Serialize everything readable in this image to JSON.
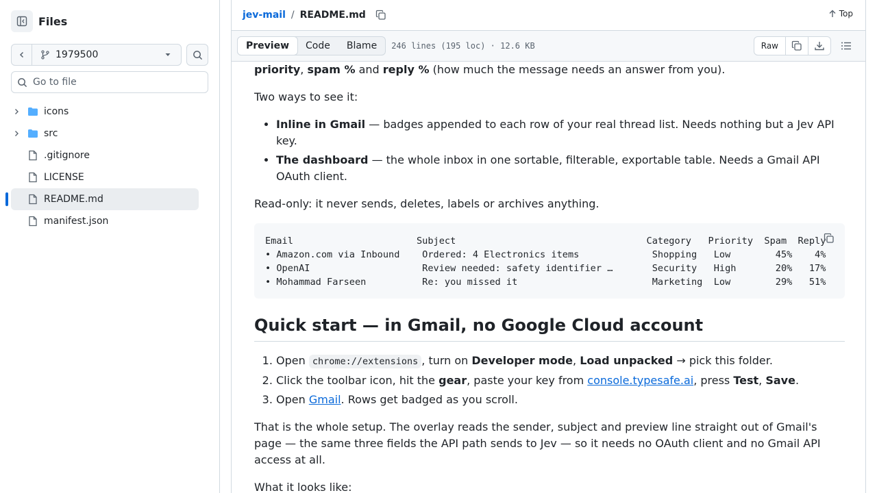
{
  "sidebar": {
    "title": "Files",
    "branch": "1979500",
    "goto_placeholder": "Go to file",
    "items": [
      {
        "label": "icons",
        "type": "folder"
      },
      {
        "label": "src",
        "type": "folder"
      },
      {
        "label": ".gitignore",
        "type": "file"
      },
      {
        "label": "LICENSE",
        "type": "file"
      },
      {
        "label": "README.md",
        "type": "file",
        "active": true
      },
      {
        "label": "manifest.json",
        "type": "file"
      }
    ]
  },
  "header": {
    "repo": "jev-mail",
    "separator": "/",
    "file": "README.md",
    "top_label": "Top"
  },
  "toolbar": {
    "tabs": [
      "Preview",
      "Code",
      "Blame"
    ],
    "active_tab": "Preview",
    "meta": "246 lines (195 loc) · 12.6 KB",
    "raw_label": "Raw"
  },
  "readme": {
    "intro_b1": "priority",
    "intro_s1": ", ",
    "intro_b2": "spam %",
    "intro_s2": " and ",
    "intro_b3": "reply %",
    "intro_s3": " (how much the message needs an answer from you).",
    "two_ways": "Two ways to see it:",
    "bullet1_b": "Inline in Gmail",
    "bullet1_t": " — badges appended to each row of your real thread list. Needs nothing but a Jev API key.",
    "bullet2_b": "The dashboard",
    "bullet2_t": " — the whole inbox in one sortable, filterable, exportable table. Needs a Gmail API OAuth client.",
    "readonly": "Read-only: it never sends, deletes, labels or archives anything.",
    "code_lines": [
      "Email                      Subject                                  Category   Priority  Spam  Reply",
      "• Amazon.com via Inbound    Ordered: 4 Electronics items             Shopping   Low        45%    4%",
      "• OpenAI                    Review needed: safety identifier …       Security   High       20%   17%",
      "• Mohammad Farseen          Re: you missed it                        Marketing  Low        29%   51%"
    ],
    "quickstart_heading": "Quick start — in Gmail, no Google Cloud account",
    "step1_a": "Open ",
    "step1_code": "chrome://extensions",
    "step1_b": ", turn on ",
    "step1_bold1": "Developer mode",
    "step1_c": ", ",
    "step1_bold2": "Load unpacked",
    "step1_d": " → pick this folder.",
    "step2_a": "Click the toolbar icon, hit the ",
    "step2_bold1": "gear",
    "step2_b": ", paste your key from ",
    "step2_link": "console.typesafe.ai",
    "step2_c": ", press ",
    "step2_bold2": "Test",
    "step2_d": ", ",
    "step2_bold3": "Save",
    "step2_e": ".",
    "step3_a": "Open ",
    "step3_link": "Gmail",
    "step3_b": ". Rows get badged as you scroll.",
    "setup_para": "That is the whole setup. The overlay reads the sender, subject and preview line straight out of Gmail's page — the same three fields the API path sends to Jev — so it needs no OAuth client and no Gmail API access at all.",
    "looks_like": "What it looks like:"
  },
  "colors": {
    "accent": "#0969da",
    "folder": "#54aeff",
    "border": "#d1d9e0"
  }
}
